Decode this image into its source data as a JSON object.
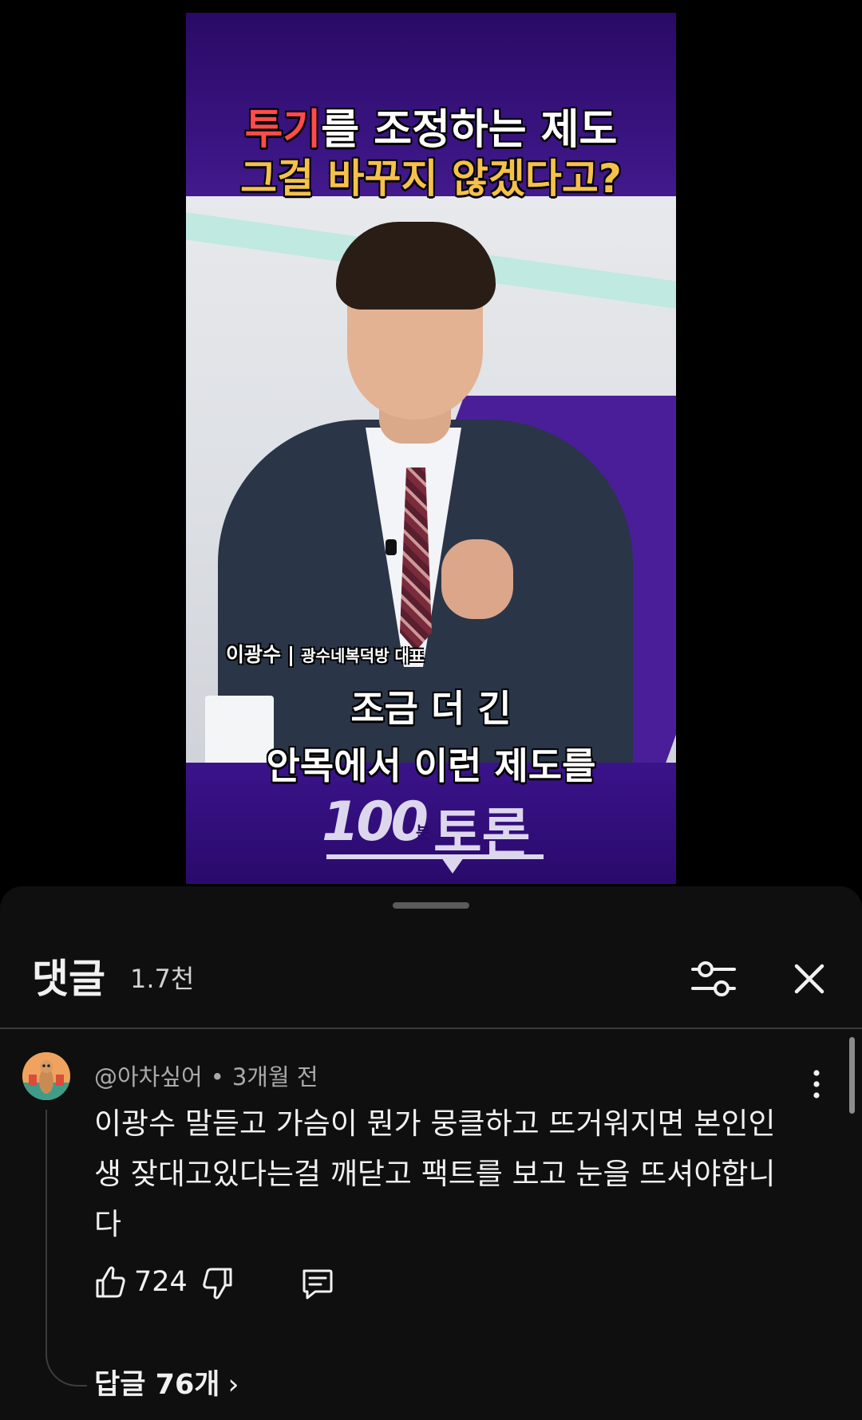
{
  "video": {
    "title_line1_red": "투기",
    "title_line1_rest": "를 조정하는 제도",
    "title_line2": "그걸 바꾸지 않겠다고?",
    "speaker_name": "이광수",
    "speaker_separator": "|",
    "speaker_role": "광수네복덕방 대표",
    "subtitle_line1": "조금 더 긴",
    "subtitle_line2": "안목에서 이런 제도를",
    "logo_number": "100",
    "logo_small": "분",
    "logo_word": "토론"
  },
  "comments_panel": {
    "title": "댓글",
    "count": "1.7천",
    "filter_icon": "sliders-icon",
    "close_icon": "close-icon"
  },
  "comment": {
    "author": "@아차싶어",
    "separator": "•",
    "time": "3개월 전",
    "text": "이광수 말듣고 가슴이 뭔가 뭉클하고 뜨거워지면 본인인생 잦대고있다는걸 깨닫고 팩트를 보고 눈을 뜨셔야합니다",
    "likes": "724",
    "replies_label": "답글 76개",
    "replies_chevron": "›"
  },
  "colors": {
    "video_purple": "#3b1583",
    "title_red": "#ff4b4b",
    "title_yellow": "#f6c14a",
    "sheet_bg": "#0f0f0f",
    "text_primary": "#f1f1f1",
    "text_secondary": "#aaaaaa"
  }
}
